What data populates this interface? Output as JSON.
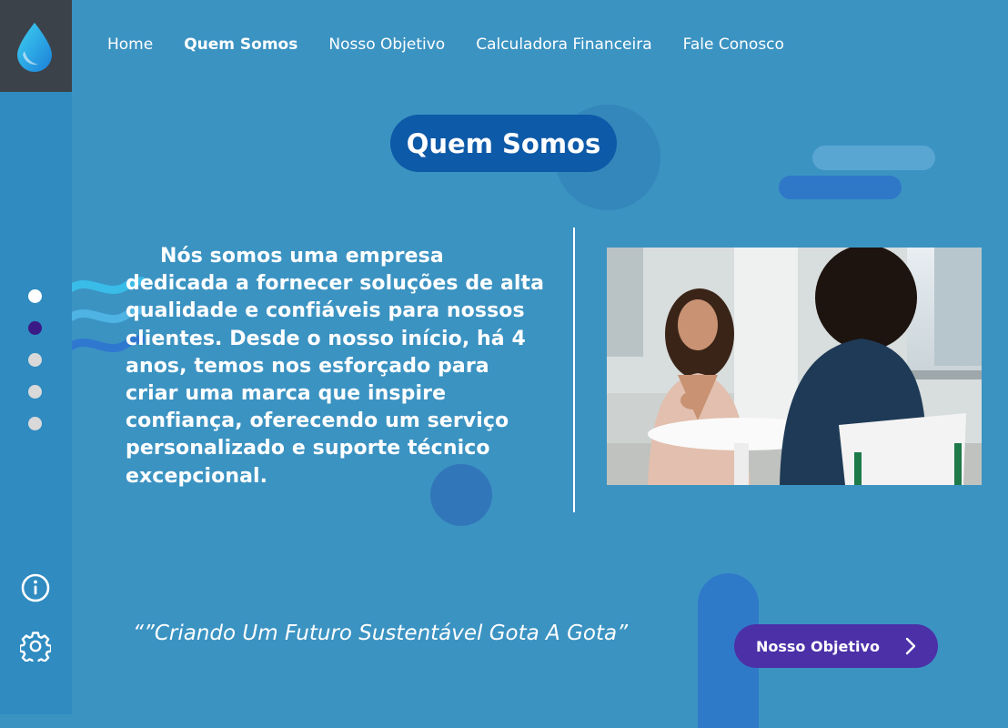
{
  "app": {
    "logo_icon": "water-drop-icon"
  },
  "nav": {
    "items": [
      {
        "label": "Home",
        "active": false
      },
      {
        "label": "Quem Somos",
        "active": true
      },
      {
        "label": "Nosso Objetivo",
        "active": false
      },
      {
        "label": "Calculadora Financeira",
        "active": false
      },
      {
        "label": "Fale Conosco",
        "active": false
      }
    ]
  },
  "pagination": {
    "total": 5,
    "active_index": 1
  },
  "sidebar": {
    "icons": [
      "info-icon",
      "gear-icon"
    ]
  },
  "main": {
    "title": "Quem Somos",
    "body": "Nós somos uma empresa dedicada a fornecer soluções de alta qualidade e confiáveis para nossos clientes. Desde o nosso início, há 4 anos, temos nos esforçado para criar uma marca que inspire confiança, oferecendo um serviço personalizado e suporte técnico excepcional.",
    "quote": "“”Criando Um Futuro Sustentável Gota A Gota”",
    "cta_label": "Nosso Objetivo",
    "cta_icon": "chevron-right-icon"
  },
  "colors": {
    "background": "#3B93C2",
    "sidebar": "#2F8BC0",
    "logo_box": "#3C424A",
    "title_pill": "#0D5AA8",
    "cta": "#4C30A8",
    "active_dot": "#3A1A87"
  }
}
